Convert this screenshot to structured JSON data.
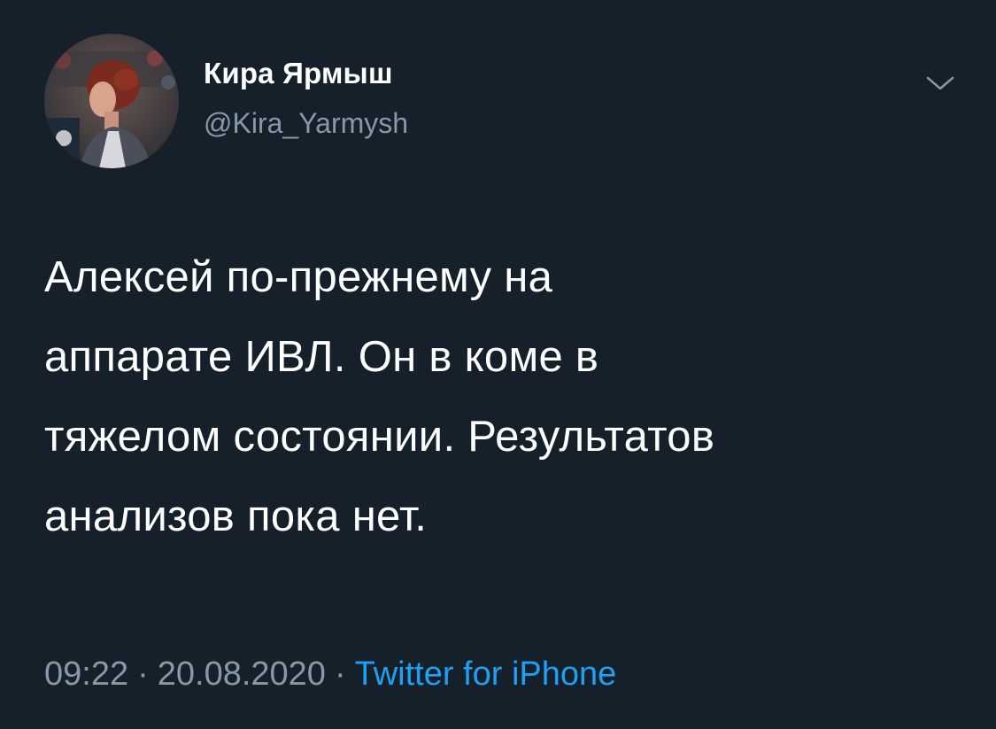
{
  "theme": {
    "background": "#15202b",
    "text_primary": "#ffffff",
    "text_secondary": "#8899a6",
    "link": "#1da1f2"
  },
  "author": {
    "display_name": "Кира Ярмыш",
    "handle": "@Kira_Yarmysh",
    "avatar_icon": "profile-photo"
  },
  "menu": {
    "icon": "chevron-down-icon"
  },
  "tweet": {
    "text_lines": [
      "Алексей по-прежнему на",
      "аппарате ИВЛ. Он в коме в",
      "тяжелом состоянии. Результатов",
      "анализов пока нет."
    ]
  },
  "meta": {
    "time": "09:22",
    "date": "20.08.2020",
    "separator": "·",
    "source": "Twitter for iPhone"
  }
}
